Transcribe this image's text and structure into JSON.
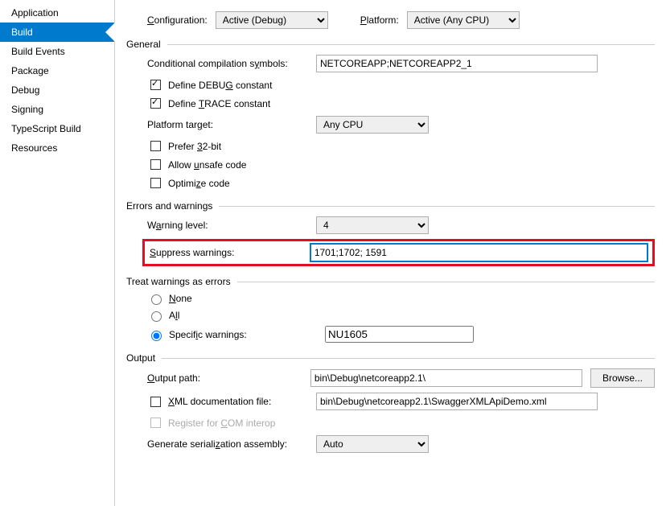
{
  "sidebar": {
    "items": [
      {
        "label": "Application"
      },
      {
        "label": "Build"
      },
      {
        "label": "Build Events"
      },
      {
        "label": "Package"
      },
      {
        "label": "Debug"
      },
      {
        "label": "Signing"
      },
      {
        "label": "TypeScript Build"
      },
      {
        "label": "Resources"
      }
    ],
    "selectedIndex": 1
  },
  "top": {
    "config_label_pre": "C",
    "config_label_post": "onfiguration:",
    "config_value": "Active (Debug)",
    "platform_label_pre": "P",
    "platform_label_post": "latform:",
    "platform_value": "Active (Any CPU)"
  },
  "general": {
    "header": "General",
    "cond_label_pre": "Conditional compilation s",
    "cond_label_u": "y",
    "cond_label_post": "mbols:",
    "cond_value": "NETCOREAPP;NETCOREAPP2_1",
    "define_debug_pre": "Define DEBU",
    "define_debug_u": "G",
    "define_debug_post": " constant",
    "define_trace_pre": "Define ",
    "define_trace_u": "T",
    "define_trace_post": "RACE constant",
    "platform_target_pre": "Platform tar",
    "platform_target_u": "g",
    "platform_target_post": "et:",
    "platform_target_value": "Any CPU",
    "prefer32_pre": "Prefer ",
    "prefer32_u": "3",
    "prefer32_post": "2-bit",
    "unsafe_pre": "Allow ",
    "unsafe_u": "u",
    "unsafe_post": "nsafe code",
    "optimize_pre": "Optimi",
    "optimize_u": "z",
    "optimize_post": "e code"
  },
  "errors": {
    "header": "Errors and warnings",
    "warning_level_pre": "W",
    "warning_level_u": "a",
    "warning_level_post": "rning level:",
    "warning_level_value": "4",
    "suppress_pre": "",
    "suppress_u": "S",
    "suppress_post": "uppress warnings:",
    "suppress_value": "1701;1702; 1591"
  },
  "treat": {
    "header": "Treat warnings as errors",
    "none_u": "N",
    "none_post": "one",
    "all_pre": "A",
    "all_u": "l",
    "all_post": "l",
    "specific_pre": "Specif",
    "specific_u": "i",
    "specific_post": "c warnings:",
    "specific_value": "NU1605"
  },
  "output": {
    "header": "Output",
    "path_u": "O",
    "path_post": "utput path:",
    "path_value": "bin\\Debug\\netcoreapp2.1\\",
    "browse": "Browse...",
    "xml_pre": "",
    "xml_u": "X",
    "xml_post": "ML documentation file:",
    "xml_value": "bin\\Debug\\netcoreapp2.1\\SwaggerXMLApiDemo.xml",
    "com_pre": "Register for ",
    "com_u": "C",
    "com_post": "OM interop",
    "serial_pre": "Generate seriali",
    "serial_u": "z",
    "serial_post": "ation assembly:",
    "serial_value": "Auto"
  }
}
